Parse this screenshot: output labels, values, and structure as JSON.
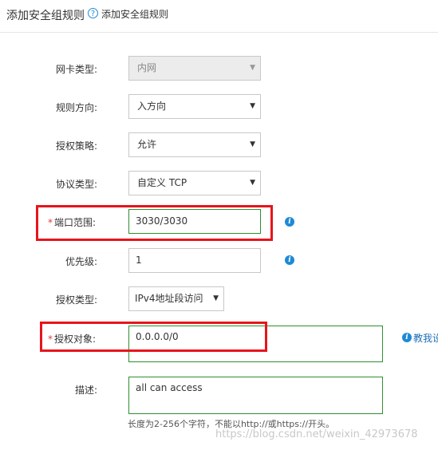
{
  "header": {
    "title": "添加安全组规则",
    "help_icon": "question-circle-icon",
    "help_text": "添加安全组规则"
  },
  "form": {
    "nic_type": {
      "label": "网卡类型:",
      "value": "内网"
    },
    "direction": {
      "label": "规则方向:",
      "value": "入方向"
    },
    "policy": {
      "label": "授权策略:",
      "value": "允许"
    },
    "protocol": {
      "label": "协议类型:",
      "value": "自定义 TCP"
    },
    "port_range": {
      "required": "*",
      "label": "端口范围:",
      "value": "3030/3030"
    },
    "priority": {
      "label": "优先级:",
      "value": "1"
    },
    "auth_type": {
      "label": "授权类型:",
      "value": "IPv4地址段访问"
    },
    "auth_object": {
      "required": "*",
      "label": "授权对象:",
      "value": "0.0.0.0/0",
      "link": "教我设"
    },
    "description": {
      "label": "描述:",
      "value": "all can access",
      "hint": "长度为2-256个字符，不能以http://或https://开头。"
    }
  },
  "caret_glyph": "▼",
  "info_glyph": "i",
  "watermark": "https://blog.csdn.net/weixin_42973678",
  "colors": {
    "accent": "#1e8ad6",
    "highlight_border": "#e8141b",
    "valid_border": "#2f8f2f",
    "required": "#e4393c"
  }
}
